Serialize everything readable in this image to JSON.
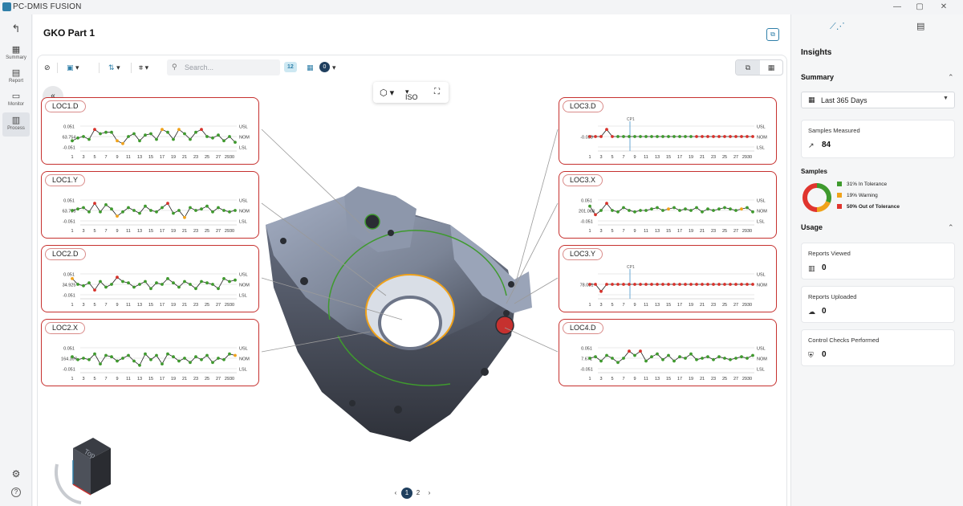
{
  "app": {
    "title": "PC-DMIS FUSION"
  },
  "window": {
    "minimize": "—",
    "restore": "▢",
    "close": "✕"
  },
  "nav": {
    "back": "↰",
    "items": [
      {
        "label": "Summary",
        "icon": "grid-icon"
      },
      {
        "label": "Report",
        "icon": "document-icon"
      },
      {
        "label": "Monitor",
        "icon": "monitor-icon"
      },
      {
        "label": "Process",
        "icon": "bar-chart-icon",
        "active": true
      }
    ],
    "settings": "⚙",
    "help": "?"
  },
  "header": {
    "part_title": "GKO Part 1"
  },
  "toolbar": {
    "search_placeholder": "Search...",
    "count_badge": "12",
    "date_count": "0"
  },
  "view": {
    "projection": "ISO"
  },
  "colors": {
    "accent": "#2f7fa9",
    "fail": "#d7322b",
    "warn": "#f0a21a",
    "ok": "#3f9a2e",
    "navy": "#1f3f5e"
  },
  "cards": [
    {
      "title": "LOC1.D",
      "usl": "0.051",
      "nom": "63.754",
      "lsl": "-0.051",
      "lbl_usl": "USL",
      "lbl_nom": "NOM",
      "lbl_lsl": "LSL"
    },
    {
      "title": "LOC1.Y",
      "usl": "0.051",
      "nom": "63.735",
      "lsl": "-0.051",
      "lbl_usl": "USL",
      "lbl_nom": "NOM",
      "lbl_lsl": "LSL"
    },
    {
      "title": "LOC2.D",
      "usl": "0.051",
      "nom": "34.925",
      "lsl": "-0.051",
      "lbl_usl": "USL",
      "lbl_nom": "NOM",
      "lbl_lsl": "LSL"
    },
    {
      "title": "LOC2.X",
      "usl": "0.051",
      "nom": "164.397",
      "lsl": "-0.051",
      "lbl_usl": "USL",
      "lbl_nom": "NOM",
      "lbl_lsl": "LSL"
    },
    {
      "title": "LOC3.D",
      "usl": "",
      "nom": "-0.058",
      "lsl": "",
      "lbl_usl": "USL",
      "lbl_nom": "NOM",
      "lbl_lsl": "LSL",
      "cp": "CP1"
    },
    {
      "title": "LOC3.X",
      "usl": "0.051",
      "nom": "201.068",
      "lsl": "-0.051",
      "lbl_usl": "USL",
      "lbl_nom": "NOM",
      "lbl_lsl": "LSL"
    },
    {
      "title": "LOC3.Y",
      "usl": "",
      "nom": "78.081",
      "lsl": "",
      "lbl_usl": "USL",
      "lbl_nom": "NOM",
      "lbl_lsl": "",
      "cp": "CP1"
    },
    {
      "title": "LOC4.D",
      "usl": "0.051",
      "nom": "7.671",
      "lsl": "-0.051",
      "lbl_usl": "USL",
      "lbl_nom": "NOM",
      "lbl_lsl": "LSL"
    }
  ],
  "x_ticks": [
    "1",
    "3",
    "5",
    "7",
    "9",
    "11",
    "13",
    "15",
    "17",
    "19",
    "21",
    "23",
    "25",
    "27",
    "2930"
  ],
  "chart_data": [
    {
      "type": "line",
      "title": "LOC1.D",
      "x": [
        1,
        2,
        3,
        4,
        5,
        6,
        7,
        8,
        9,
        10,
        11,
        12,
        13,
        14,
        15,
        16,
        17,
        18,
        19,
        20,
        21,
        22,
        23,
        24,
        25,
        26,
        27,
        28,
        29,
        30
      ],
      "values": [
        -0.03,
        -0.01,
        0.0,
        -0.02,
        0.05,
        0.02,
        0.03,
        0.03,
        -0.03,
        -0.05,
        0.0,
        0.02,
        -0.03,
        0.01,
        0.02,
        -0.02,
        0.05,
        0.03,
        -0.02,
        0.05,
        0.02,
        -0.02,
        0.03,
        0.05,
        0.0,
        -0.01,
        0.01,
        -0.03,
        0.0,
        -0.04
      ],
      "status": [
        "ok",
        "ok",
        "ok",
        "ok",
        "fail",
        "ok",
        "ok",
        "ok",
        "warn",
        "warn",
        "ok",
        "ok",
        "ok",
        "ok",
        "ok",
        "ok",
        "warn",
        "ok",
        "ok",
        "warn",
        "ok",
        "ok",
        "ok",
        "fail",
        "ok",
        "ok",
        "ok",
        "ok",
        "ok",
        "ok"
      ],
      "ylim": [
        -0.07,
        0.07
      ]
    },
    {
      "type": "line",
      "title": "LOC1.Y",
      "x": [
        1,
        2,
        3,
        4,
        5,
        6,
        7,
        8,
        9,
        10,
        11,
        12,
        13,
        14,
        15,
        16,
        17,
        18,
        19,
        20,
        21,
        22,
        23,
        24,
        25,
        26,
        27,
        28,
        29,
        30
      ],
      "values": [
        0.0,
        0.01,
        0.02,
        -0.01,
        0.05,
        -0.01,
        0.04,
        0.01,
        -0.04,
        -0.01,
        0.02,
        0.0,
        -0.02,
        0.03,
        0.0,
        -0.01,
        0.02,
        0.05,
        -0.02,
        0.0,
        -0.05,
        0.02,
        0.0,
        0.01,
        0.03,
        -0.01,
        0.02,
        0.0,
        -0.01,
        0.0
      ],
      "status": [
        "ok",
        "ok",
        "ok",
        "ok",
        "fail",
        "ok",
        "ok",
        "ok",
        "warn",
        "ok",
        "ok",
        "ok",
        "ok",
        "ok",
        "ok",
        "ok",
        "ok",
        "fail",
        "ok",
        "ok",
        "warn",
        "ok",
        "ok",
        "ok",
        "ok",
        "ok",
        "ok",
        "ok",
        "ok",
        "ok"
      ],
      "ylim": [
        -0.07,
        0.07
      ]
    },
    {
      "type": "line",
      "title": "LOC2.D",
      "x": [
        1,
        2,
        3,
        4,
        5,
        6,
        7,
        8,
        9,
        10,
        11,
        12,
        13,
        14,
        15,
        16,
        17,
        18,
        19,
        20,
        21,
        22,
        23,
        24,
        25,
        26,
        27,
        28,
        29,
        30
      ],
      "values": [
        0.04,
        0.0,
        -0.01,
        0.01,
        -0.04,
        0.02,
        -0.02,
        0.0,
        0.05,
        0.02,
        0.01,
        -0.02,
        0.0,
        0.02,
        -0.03,
        0.01,
        0.0,
        0.04,
        0.01,
        -0.02,
        0.02,
        0.0,
        -0.03,
        0.02,
        0.01,
        0.0,
        -0.03,
        0.04,
        0.02,
        0.03
      ],
      "status": [
        "warn",
        "ok",
        "ok",
        "ok",
        "fail",
        "ok",
        "ok",
        "ok",
        "fail",
        "ok",
        "ok",
        "ok",
        "ok",
        "ok",
        "ok",
        "ok",
        "ok",
        "ok",
        "ok",
        "ok",
        "ok",
        "ok",
        "ok",
        "ok",
        "ok",
        "ok",
        "ok",
        "ok",
        "ok",
        "ok"
      ],
      "ylim": [
        -0.07,
        0.07
      ]
    },
    {
      "type": "line",
      "title": "LOC2.X",
      "x": [
        1,
        2,
        3,
        4,
        5,
        6,
        7,
        8,
        9,
        10,
        11,
        12,
        13,
        14,
        15,
        16,
        17,
        18,
        19,
        20,
        21,
        22,
        23,
        24,
        25,
        26,
        27,
        28,
        29,
        30
      ],
      "values": [
        0.01,
        -0.01,
        0.0,
        -0.01,
        0.03,
        -0.04,
        0.02,
        0.01,
        -0.02,
        0.0,
        0.02,
        -0.02,
        -0.05,
        0.03,
        -0.01,
        0.02,
        -0.04,
        0.03,
        0.01,
        -0.02,
        0.0,
        -0.03,
        0.01,
        -0.01,
        0.02,
        -0.03,
        0.0,
        -0.01,
        0.03,
        0.02
      ],
      "status": [
        "ok",
        "ok",
        "ok",
        "ok",
        "ok",
        "ok",
        "ok",
        "ok",
        "ok",
        "ok",
        "ok",
        "ok",
        "ok",
        "ok",
        "ok",
        "ok",
        "ok",
        "ok",
        "ok",
        "ok",
        "ok",
        "ok",
        "ok",
        "ok",
        "ok",
        "ok",
        "ok",
        "ok",
        "ok",
        "warn"
      ],
      "ylim": [
        -0.07,
        0.07
      ]
    },
    {
      "type": "line",
      "title": "LOC3.D",
      "x": [
        1,
        2,
        3,
        4,
        5,
        6,
        7,
        8,
        9,
        10,
        11,
        12,
        13,
        14,
        15,
        16,
        17,
        18,
        19,
        20,
        21,
        22,
        23,
        24,
        25,
        26,
        27,
        28,
        29,
        30
      ],
      "values": [
        0.0,
        0.0,
        0.0,
        0.05,
        0.0,
        0.0,
        0.0,
        0.0,
        0.0,
        0.0,
        0.0,
        0.0,
        0.0,
        0.0,
        0.0,
        0.0,
        0.0,
        0.0,
        0.0,
        0.0,
        0.0,
        0.0,
        0.0,
        0.0,
        0.0,
        0.0,
        0.0,
        0.0,
        0.0,
        0.0
      ],
      "status": [
        "fail",
        "fail",
        "fail",
        "fail",
        "fail",
        "ok",
        "ok",
        "ok",
        "ok",
        "ok",
        "ok",
        "ok",
        "ok",
        "ok",
        "ok",
        "ok",
        "ok",
        "ok",
        "ok",
        "fail",
        "fail",
        "fail",
        "fail",
        "fail",
        "fail",
        "fail",
        "fail",
        "fail",
        "fail",
        "fail"
      ],
      "ylim": [
        -0.07,
        0.07
      ]
    },
    {
      "type": "line",
      "title": "LOC3.X",
      "x": [
        1,
        2,
        3,
        4,
        5,
        6,
        7,
        8,
        9,
        10,
        11,
        12,
        13,
        14,
        15,
        16,
        17,
        18,
        19,
        20,
        21,
        22,
        23,
        24,
        25,
        26,
        27,
        28,
        29,
        30
      ],
      "values": [
        0.03,
        -0.03,
        0.0,
        0.05,
        0.0,
        -0.01,
        0.02,
        0.0,
        -0.01,
        0.0,
        0.0,
        0.01,
        0.02,
        0.0,
        0.01,
        0.02,
        0.0,
        0.01,
        0.0,
        0.02,
        -0.01,
        0.01,
        0.0,
        0.01,
        0.02,
        0.01,
        0.0,
        0.01,
        0.02,
        -0.01
      ],
      "status": [
        "ok",
        "fail",
        "ok",
        "fail",
        "ok",
        "ok",
        "ok",
        "ok",
        "ok",
        "ok",
        "ok",
        "ok",
        "ok",
        "ok",
        "warn",
        "ok",
        "ok",
        "ok",
        "ok",
        "ok",
        "ok",
        "ok",
        "ok",
        "ok",
        "ok",
        "ok",
        "ok",
        "warn",
        "ok",
        "ok"
      ],
      "ylim": [
        -0.07,
        0.07
      ]
    },
    {
      "type": "line",
      "title": "LOC3.Y",
      "x": [
        1,
        2,
        3,
        4,
        5,
        6,
        7,
        8,
        9,
        10,
        11,
        12,
        13,
        14,
        15,
        16,
        17,
        18,
        19,
        20,
        21,
        22,
        23,
        24,
        25,
        26,
        27,
        28,
        29,
        30
      ],
      "values": [
        0.0,
        0.0,
        -0.05,
        0.0,
        0.0,
        0.0,
        0.0,
        0.0,
        0.0,
        0.0,
        0.0,
        0.0,
        0.0,
        0.0,
        0.0,
        0.0,
        0.0,
        0.0,
        0.0,
        0.0,
        0.0,
        0.0,
        0.0,
        0.0,
        0.0,
        0.0,
        0.0,
        0.0,
        0.0,
        0.0
      ],
      "status": [
        "fail",
        "fail",
        "fail",
        "fail",
        "fail",
        "fail",
        "fail",
        "fail",
        "fail",
        "fail",
        "fail",
        "fail",
        "fail",
        "fail",
        "fail",
        "fail",
        "fail",
        "fail",
        "fail",
        "fail",
        "fail",
        "fail",
        "fail",
        "fail",
        "fail",
        "fail",
        "fail",
        "fail",
        "fail",
        "fail"
      ],
      "ylim": [
        -0.07,
        0.07
      ]
    },
    {
      "type": "line",
      "title": "LOC4.D",
      "x": [
        1,
        2,
        3,
        4,
        5,
        6,
        7,
        8,
        9,
        10,
        11,
        12,
        13,
        14,
        15,
        16,
        17,
        18,
        19,
        20,
        21,
        22,
        23,
        24,
        25,
        26,
        27,
        28,
        29,
        30
      ],
      "values": [
        0.0,
        0.01,
        -0.02,
        0.02,
        0.0,
        -0.03,
        0.0,
        0.05,
        0.02,
        0.05,
        -0.02,
        0.01,
        0.03,
        -0.01,
        0.02,
        -0.02,
        0.01,
        0.0,
        0.03,
        -0.01,
        0.0,
        0.01,
        -0.01,
        0.01,
        0.0,
        -0.01,
        0.0,
        0.01,
        0.0,
        0.02
      ],
      "status": [
        "ok",
        "ok",
        "ok",
        "ok",
        "ok",
        "ok",
        "ok",
        "fail",
        "ok",
        "fail",
        "ok",
        "ok",
        "ok",
        "ok",
        "ok",
        "ok",
        "ok",
        "ok",
        "ok",
        "ok",
        "ok",
        "ok",
        "ok",
        "ok",
        "ok",
        "ok",
        "ok",
        "ok",
        "ok",
        "ok"
      ],
      "ylim": [
        -0.07,
        0.07
      ]
    }
  ],
  "pager": {
    "pages": [
      "1",
      "2"
    ],
    "prev": "‹",
    "next": "›"
  },
  "insights": {
    "title": "Insights",
    "summary_title": "Summary",
    "range": "Last 365 Days",
    "samples_measured_label": "Samples Measured",
    "samples_measured_value": "84",
    "samples_title": "Samples",
    "donut": [
      {
        "label": "31% In Tolerance",
        "value": 31,
        "color": "#3f9a2e"
      },
      {
        "label": "19% Warning",
        "value": 19,
        "color": "#f0a21a"
      },
      {
        "label": "50% Out of Tolerance",
        "value": 50,
        "color": "#e0352e"
      }
    ],
    "usage_title": "Usage",
    "reports_viewed_label": "Reports Viewed",
    "reports_viewed_value": "0",
    "reports_uploaded_label": "Reports Uploaded",
    "reports_uploaded_value": "0",
    "control_checks_label": "Control Checks Performed",
    "control_checks_value": "0"
  }
}
